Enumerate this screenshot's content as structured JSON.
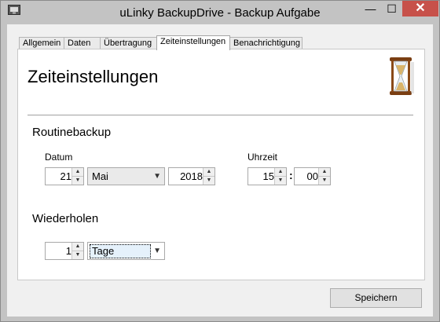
{
  "window": {
    "title": "uLinky BackupDrive - Backup Aufgabe",
    "controls": {
      "minimize": "—",
      "maximize": "☐",
      "close": "✕"
    }
  },
  "tabs": [
    {
      "label": "Allgemein",
      "active": false
    },
    {
      "label": "Daten",
      "active": false
    },
    {
      "label": "Übertragung",
      "active": false
    },
    {
      "label": "Zeiteinstellungen",
      "active": true
    },
    {
      "label": "Benachrichtigung",
      "active": false
    }
  ],
  "page": {
    "heading": "Zeiteinstellungen",
    "icon": "hourglass-icon"
  },
  "routine": {
    "title": "Routinebackup",
    "date_label": "Datum",
    "day": "21",
    "month": "Mai",
    "year": "2018",
    "time_label": "Uhrzeit",
    "hour": "15",
    "separator": ":",
    "minute": "00"
  },
  "repeat": {
    "title": "Wiederholen",
    "count": "1",
    "unit": "Tage"
  },
  "footer": {
    "save_label": "Speichern"
  }
}
